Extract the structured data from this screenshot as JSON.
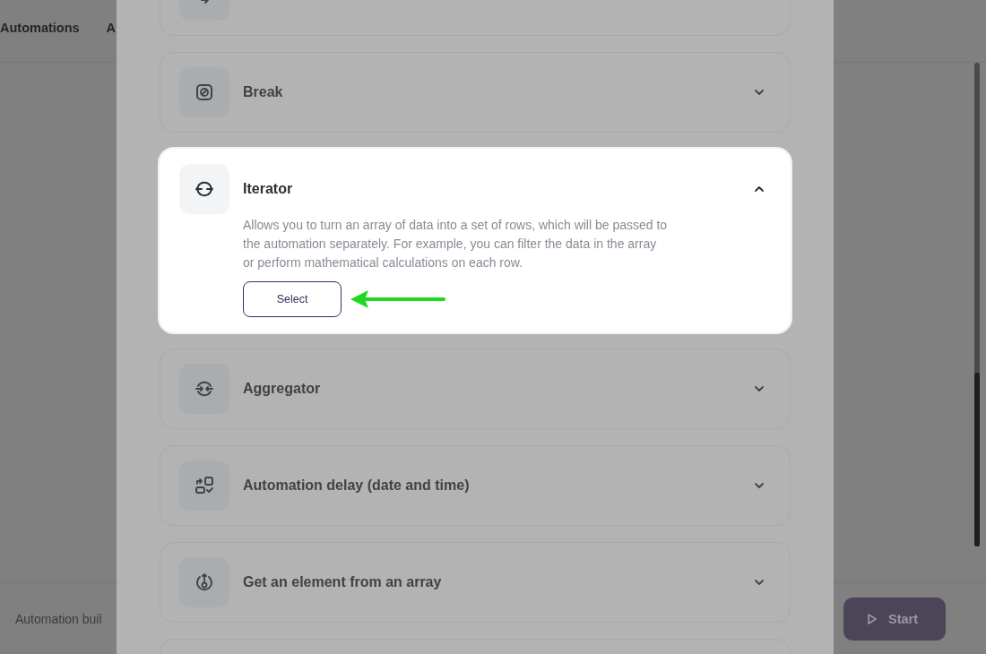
{
  "header": {
    "tabs": [
      {
        "label": "Automations"
      },
      {
        "label": "A"
      }
    ]
  },
  "footer": {
    "caption": "Automation buil",
    "start_button": "Start"
  },
  "modal": {
    "items": [
      {
        "kind": "redirect",
        "highlighted": false
      },
      {
        "kind": "break",
        "title": "Break",
        "expanded": false,
        "highlighted": false
      },
      {
        "kind": "iterator",
        "title": "Iterator",
        "expanded": true,
        "highlighted": true,
        "pointed": true,
        "description": "Allows you to turn an array of data into a set of rows, which will be passed to the automation separately. For example, you can filter the data in the array or perform mathematical calculations on each row.",
        "button": "Select"
      },
      {
        "kind": "aggregator",
        "title": "Aggregator",
        "expanded": false,
        "highlighted": false
      },
      {
        "kind": "delay",
        "title": "Automation delay (date and time)",
        "expanded": false,
        "highlighted": false
      },
      {
        "kind": "get-element",
        "title": "Get an element from an array",
        "expanded": false,
        "highlighted": false
      },
      {
        "kind": "unknown",
        "highlighted": false
      }
    ]
  }
}
